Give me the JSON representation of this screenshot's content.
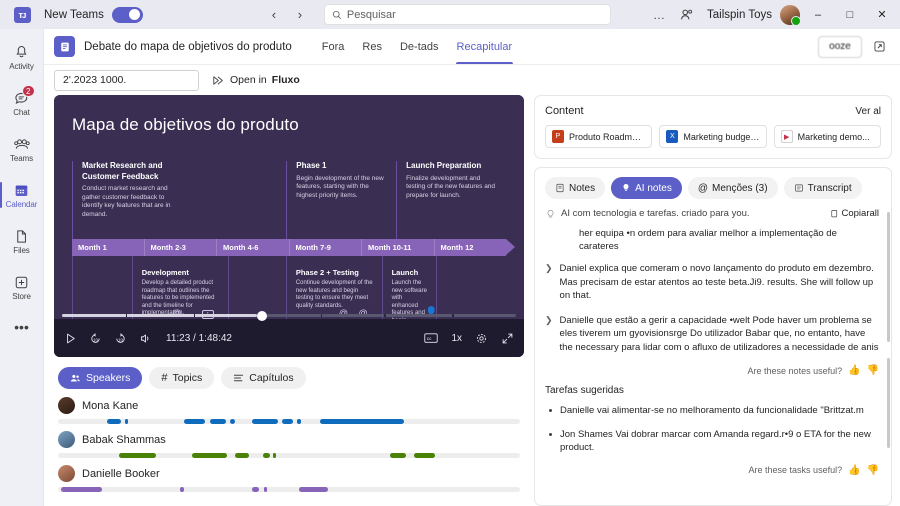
{
  "titlebar": {
    "app_name": "New Teams",
    "toggle_on": true,
    "nav_back": "‹",
    "nav_forward": "›",
    "search_placeholder": "Pesquisar",
    "search_icon": "search-icon",
    "more_icon": "…",
    "people_icon": "people-icon",
    "org_name": "Tailspin Toys",
    "minimize": "–",
    "maximize": "□",
    "close": "✕"
  },
  "rail": {
    "items": [
      {
        "label": "Activity",
        "icon": "bell-icon",
        "badge": ""
      },
      {
        "label": "Chat",
        "icon": "chat-icon",
        "badge": "2"
      },
      {
        "label": "Teams",
        "icon": "teams-icon",
        "badge": ""
      },
      {
        "label": "Calendar",
        "icon": "calendar-icon",
        "badge": ""
      },
      {
        "label": "Files",
        "icon": "file-icon",
        "badge": ""
      },
      {
        "label": "Store",
        "icon": "plus-box-icon",
        "badge": ""
      }
    ],
    "more": "•••"
  },
  "meeting": {
    "icon": "meeting-notes-icon",
    "title": "Debate do mapa de objetivos do produto",
    "tabs": [
      {
        "label": "Fora"
      },
      {
        "label": "Res"
      },
      {
        "label": "De-tads"
      },
      {
        "label": "Recapitular"
      }
    ],
    "active_tab_index": 3,
    "action_button": "ooze",
    "popout_icon": "popout-icon"
  },
  "subbar": {
    "date_value": "2'.2023 1000.",
    "open_in_label": "Open in",
    "open_in_target": "Fluxo",
    "flow_icon": "flow-icon"
  },
  "video": {
    "slide_title": "Mapa de objetivos do produto",
    "top_blocks": [
      {
        "heading": "Market Research and Customer Feedback",
        "body": "Conduct market research and gather customer feedback to identify key features that are in demand."
      },
      {
        "heading": "Phase 1",
        "body": "Begin development of the new features, starting with the highest priority items."
      },
      {
        "heading": "Launch Preparation",
        "body": "Finalize development and testing of the new features and prepare for launch."
      }
    ],
    "timeline": [
      "Month 1",
      "Month 2-3",
      "Month 4-6",
      "Month 7-9",
      "Month 10-11",
      "Month 12"
    ],
    "bottom_blocks": [
      {
        "heading": "Development",
        "body": "Develop a detailed product roadmap that outlines the features to be implemented and the timeline for implementation."
      },
      {
        "heading": "Phase 2 + Testing",
        "body": "Continue development of the new features and begin testing to ensure they meet quality standards."
      },
      {
        "heading": "Launch",
        "body": "Launch the new software with enhanced features and begin monitoring customer feedback to ensure satisfaction and identify areas for improvement."
      }
    ],
    "controls": {
      "play": "play-icon",
      "rewind10": "rewind-10-icon",
      "forward10": "forward-10-icon",
      "volume": "volume-icon",
      "time": "11:23 / 1:48:42",
      "captions": "captions-icon",
      "speed": "1x",
      "settings": "gear-icon",
      "fullscreen": "fullscreen-icon",
      "progress_percent": 43
    }
  },
  "speakers_panel": {
    "tabs": [
      {
        "label": "Speakers",
        "icon": "people-icon"
      },
      {
        "label": "Topics",
        "icon": "hash-icon"
      },
      {
        "label": "Capítulos",
        "icon": "list-icon"
      }
    ],
    "active_tab_index": 0,
    "speakers": [
      {
        "name": "Mona Kane",
        "color": "#0f6cbd",
        "segments": [
          {
            "left": 10.5,
            "width": 3.2
          },
          {
            "left": 14.6,
            "width": 0.6
          },
          {
            "left": 27.3,
            "width": 4.6
          },
          {
            "left": 32.8,
            "width": 3.5
          },
          {
            "left": 37.3,
            "width": 1.1
          },
          {
            "left": 42.0,
            "width": 5.6
          },
          {
            "left": 48.4,
            "width": 2.4
          },
          {
            "left": 51.8,
            "width": 0.9
          },
          {
            "left": 56.8,
            "width": 18.0
          }
        ]
      },
      {
        "name": "Babak Shammas",
        "color": "#498205",
        "segments": [
          {
            "left": 13.2,
            "width": 8.0
          },
          {
            "left": 29.0,
            "width": 7.5
          },
          {
            "left": 38.4,
            "width": 2.9
          },
          {
            "left": 44.4,
            "width": 1.4
          },
          {
            "left": 46.5,
            "width": 0.6
          },
          {
            "left": 71.8,
            "width": 3.6
          },
          {
            "left": 77.0,
            "width": 4.6
          }
        ]
      },
      {
        "name": "Danielle Booker",
        "color": "#8764b8",
        "segments": [
          {
            "left": 0.6,
            "width": 9.0
          },
          {
            "left": 26.5,
            "width": 0.7
          },
          {
            "left": 42.0,
            "width": 1.6
          },
          {
            "left": 44.6,
            "width": 0.7
          },
          {
            "left": 52.2,
            "width": 6.2
          }
        ]
      }
    ]
  },
  "content_panel": {
    "title": "Content",
    "see_all": "Ver al",
    "files": [
      {
        "name": "Produto  Roadmap...",
        "type": "ppt"
      },
      {
        "name": "Marketing  budget...",
        "type": "xls"
      },
      {
        "name": "Marketing  demo...",
        "type": "vid"
      }
    ]
  },
  "notes_panel": {
    "tabs": [
      {
        "label": "Notes",
        "icon": "notes-icon"
      },
      {
        "label": "AI notes",
        "icon": "bulb-icon"
      },
      {
        "label": "Menções (3)",
        "icon": "at-icon"
      },
      {
        "label": "Transcript",
        "icon": "transcript-icon"
      }
    ],
    "active_tab_index": 1,
    "ai_header": "AI com tecnologia e tarefas. criado para           you.",
    "copy_all": "Copiarall",
    "copy_icon": "copy-icon",
    "bulb_icon": "bulb-icon",
    "lead_line": "her equipa •n ordem para avaliar melhor a implementação de carateres",
    "bullets": [
      "Daniel explica que comeram o novo lançamento do produto em dezembro. Mas precisam de estar atentos ao teste beta.Ji9.            results. She will follow up on that.",
      "Danielle que estão a gerir a capacidade •welt Pode haver um problema se eles tiverem um gyovisionsrge Do utilizador Babar que, no entanto,        have the necessary para lidar com o afluxo de utilizadores a necessidade de anis"
    ],
    "notes_feedback": "Are these notes useful?",
    "tasks_title": "Tarefas sugeridas",
    "tasks": [
      "Danielle vai alimentar-se no melhoramento da funcionalidade \"Brittzat.m",
      "Jon Shames Vai dobrar marcar com Amanda regard.r•9 o ETA        for the new product."
    ],
    "tasks_feedback": "Are these tasks useful?",
    "thumbs_up": "thumbs-up-icon",
    "thumbs_down": "thumbs-down-icon"
  }
}
